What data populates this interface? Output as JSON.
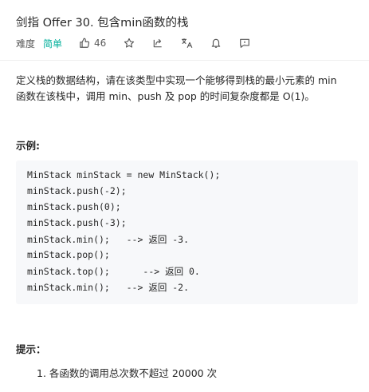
{
  "problem": {
    "title": "剑指 Offer 30. 包含min函数的栈",
    "difficulty_label": "难度",
    "difficulty": "简单",
    "likes": "46",
    "icons": [
      "thumbs-up-icon",
      "star-icon",
      "share-icon",
      "translate-icon",
      "bell-icon",
      "comment-icon"
    ]
  },
  "description": {
    "line1": "定义栈的数据结构，请在该类型中实现一个能够得到栈的最小元素的 min",
    "line2": "函数在该栈中，调用 min、push 及 pop 的时间复杂度都是 O(1)。"
  },
  "example": {
    "heading": "示例:",
    "code_lines": [
      "MinStack minStack = new MinStack();",
      "minStack.push(-2);",
      "minStack.push(0);",
      "minStack.push(-3);",
      "minStack.min();   --> 返回 -3.",
      "minStack.pop();",
      "minStack.top();      --> 返回 0.",
      "minStack.min();   --> 返回 -2."
    ]
  },
  "hints": {
    "heading": "提示：",
    "items": [
      "1. 各函数的调用总次数不超过 20000 次"
    ]
  },
  "colors": {
    "easy": "#00af9b",
    "text": "#262626",
    "muted": "#595959",
    "code_bg": "#f7f8fa"
  }
}
